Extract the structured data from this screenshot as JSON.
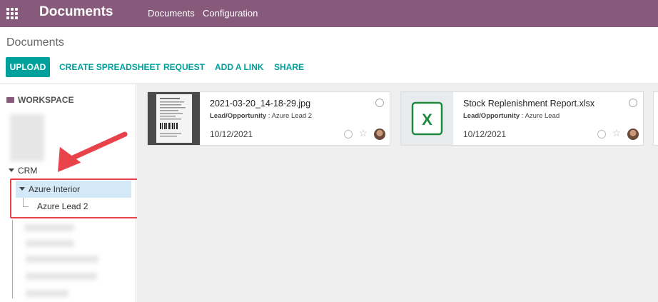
{
  "topbar": {
    "app_title": "Documents",
    "menu": [
      "Documents",
      "Configuration"
    ]
  },
  "control_panel": {
    "breadcrumb": "Documents",
    "buttons": {
      "upload": "UPLOAD",
      "create_spreadsheet": "CREATE SPREADSHEET",
      "request": "REQUEST",
      "add_link": "ADD A LINK",
      "share": "SHARE"
    }
  },
  "sidebar": {
    "header": "WORKSPACE",
    "crm": "CRM",
    "azure_interior": "Azure Interior",
    "azure_lead": "Azure Lead 2"
  },
  "documents": [
    {
      "name": "2021-03-20_14-18-29.jpg",
      "field_label": "Lead/Opportunity",
      "field_value": " : Azure Lead 2",
      "date": "10/12/2021",
      "thumb": "image"
    },
    {
      "name": "Stock Replenishment Report.xlsx",
      "field_label": "Lead/Opportunity",
      "field_value": " : Azure Lead",
      "date": "10/12/2021",
      "thumb": "spreadsheet",
      "icon_text": "X"
    }
  ],
  "colors": {
    "brand": "#875a7b",
    "accent": "#00a09d",
    "annotation": "#e8424a",
    "excel_green": "#1e8a3e"
  }
}
